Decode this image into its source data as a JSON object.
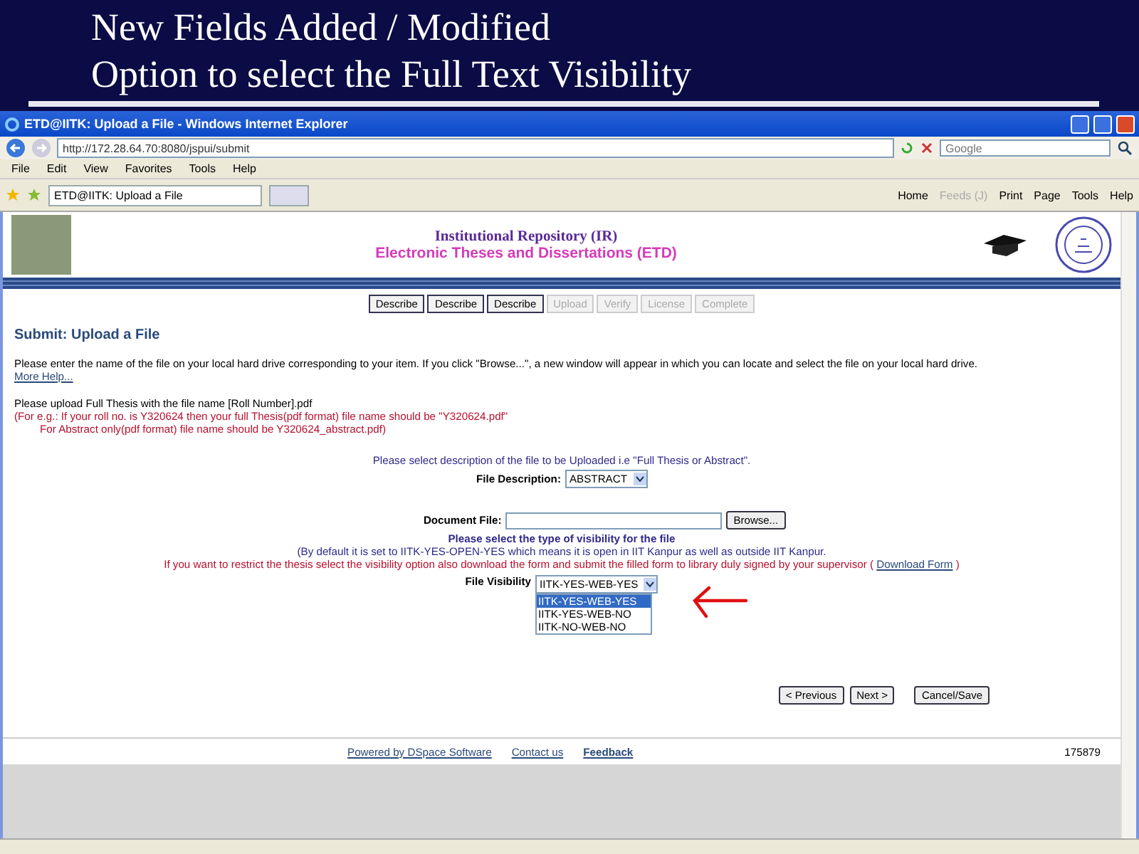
{
  "slide": {
    "title_lines": [
      "New Fields Added / Modified",
      "Option to select the Full Text Visibility"
    ]
  },
  "browser": {
    "title": "ETD@IITK: Upload a File - Windows Internet Explorer",
    "address": "http://172.28.64.70:8080/jspui/submit",
    "search_placeholder": "Google",
    "menu": [
      "File",
      "Edit",
      "View",
      "Favorites",
      "Tools",
      "Help"
    ],
    "tab": "ETD@IITK: Upload a File",
    "toolbar": [
      {
        "label": "Home",
        "disabled": false
      },
      {
        "label": "Feeds (J)",
        "disabled": true
      },
      {
        "label": "Print",
        "disabled": false
      },
      {
        "label": "Page",
        "disabled": false
      },
      {
        "label": "Tools",
        "disabled": false
      },
      {
        "label": "Help",
        "disabled": false
      }
    ]
  },
  "page": {
    "header": {
      "line1": "Institutional Repository (IR)",
      "line2": "Electronic Theses and Dissertations (ETD)"
    },
    "steps": [
      {
        "label": "Describe",
        "disabled": false
      },
      {
        "label": "Describe",
        "disabled": false
      },
      {
        "label": "Describe",
        "disabled": false
      },
      {
        "label": "Upload",
        "disabled": true
      },
      {
        "label": "Verify",
        "disabled": true
      },
      {
        "label": "License",
        "disabled": true
      },
      {
        "label": "Complete",
        "disabled": true
      }
    ],
    "heading": "Submit: Upload a File",
    "intro": "Please enter the name of the file on your local hard drive corresponding to your item. If you click \"Browse...\", a new window will appear in which you can locate and select the file on your local hard drive.",
    "more_help": "More Help...",
    "upload_note": "Please upload Full Thesis with the file name [Roll Number].pdf",
    "example_lines": [
      "(For e.g.: If your roll no. is Y320624 then your full Thesis(pdf format) file name should be \"Y320624.pdf\"",
      "For Abstract only(pdf format) file name should be Y320624_abstract.pdf)"
    ],
    "description_prompt": "Please select description of the file to be Uploaded i.e \"Full Thesis or Abstract\".",
    "file_description": {
      "label": "File Description:",
      "value": "ABSTRACT"
    },
    "document_file": {
      "label": "Document File:",
      "browse": "Browse..."
    },
    "visibility_prompt": "Please select the type of visibility for the file",
    "visibility_default": "(By default it is set to IITK-YES-OPEN-YES which means it is open in IIT Kanpur as well as outside IIT Kanpur.",
    "visibility_restrict": "If you want to restrict the thesis select the visibility option also download the form and submit the filled form to library duly signed by your supervisor (",
    "download_form": "Download Form",
    "visibility_restrict_end": ")",
    "file_visibility": {
      "label": "File Visibility",
      "value": "IITK-YES-WEB-YES",
      "options": [
        {
          "label": "IITK-YES-WEB-YES",
          "selected": true
        },
        {
          "label": "IITK-YES-WEB-NO",
          "selected": false
        },
        {
          "label": "IITK-NO-WEB-NO",
          "selected": false
        }
      ]
    },
    "nav": [
      "< Previous",
      "Next >",
      "Cancel/Save"
    ],
    "footer": {
      "links": [
        "Powered by DSpace Software",
        "Contact us",
        "Feedback"
      ],
      "count": "175879"
    }
  }
}
